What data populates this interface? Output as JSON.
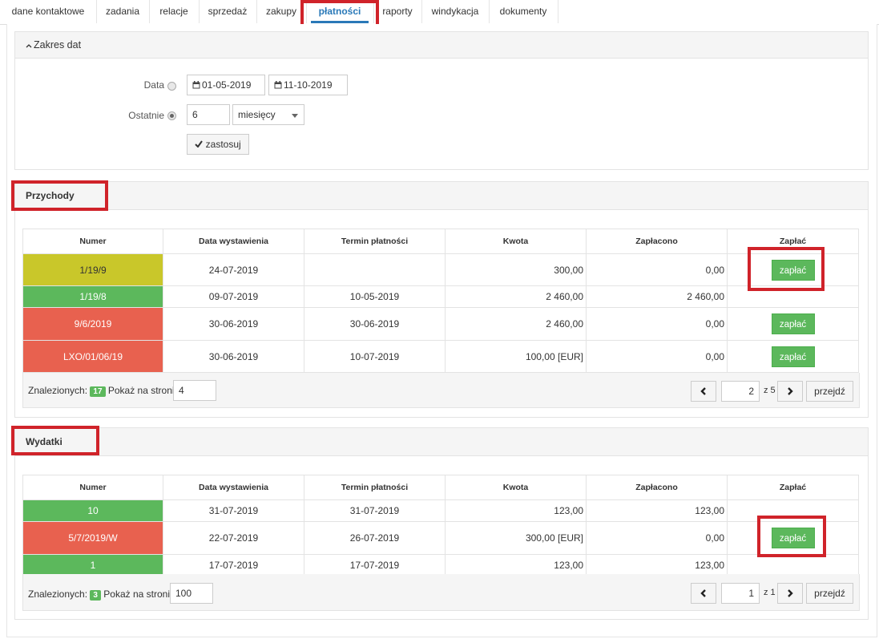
{
  "tabs": [
    "dane kontaktowe",
    "zadania",
    "relacje",
    "sprzedaż",
    "zakupy",
    "płatności",
    "raporty",
    "windykacja",
    "dokumenty"
  ],
  "date_range": {
    "title": "Zakres dat",
    "data_label": "Data",
    "date_from": "01-05-2019",
    "date_to": "11-10-2019",
    "last_label": "Ostatnie",
    "last_value": "6",
    "unit": "miesięcy",
    "apply_label": "zastosuj"
  },
  "columns": [
    "Numer",
    "Data wystawienia",
    "Termin płatności",
    "Kwota",
    "Zapłacono",
    "Zapłać"
  ],
  "pay_label": "zapłać",
  "income": {
    "title": "Przychody",
    "rows": [
      {
        "numer": "1/19/9",
        "data": "24-07-2019",
        "termin": "",
        "kwota": "300,00",
        "zaplacono": "0,00",
        "status_color": "#c9c72a",
        "pay": true
      },
      {
        "numer": "1/19/8",
        "data": "09-07-2019",
        "termin": "10-05-2019",
        "kwota": "2 460,00",
        "zaplacono": "2 460,00",
        "status_color": "#5cb85c",
        "pay": false
      },
      {
        "numer": "9/6/2019",
        "data": "30-06-2019",
        "termin": "30-06-2019",
        "kwota": "2 460,00",
        "zaplacono": "0,00",
        "status_color": "#e8614f",
        "pay": true
      },
      {
        "numer": "LXO/01/06/19",
        "data": "30-06-2019",
        "termin": "10-07-2019",
        "kwota": "100,00 [EUR]",
        "zaplacono": "0,00",
        "status_color": "#e8614f",
        "pay": true
      }
    ],
    "found_label": "Znalezionych:",
    "found_count": "17",
    "per_page_label": "Pokaż na stronie:",
    "per_page": "4",
    "page": "2",
    "of_pages": "z 5",
    "go_label": "przejdź"
  },
  "expenses": {
    "title": "Wydatki",
    "rows": [
      {
        "numer": "10",
        "data": "31-07-2019",
        "termin": "31-07-2019",
        "kwota": "123,00",
        "zaplacono": "123,00",
        "status_color": "#5cb85c",
        "pay": false
      },
      {
        "numer": "5/7/2019/W",
        "data": "22-07-2019",
        "termin": "26-07-2019",
        "kwota": "300,00 [EUR]",
        "zaplacono": "0,00",
        "status_color": "#e8614f",
        "pay": true
      },
      {
        "numer": "1",
        "data": "17-07-2019",
        "termin": "17-07-2019",
        "kwota": "123,00",
        "zaplacono": "123,00",
        "status_color": "#5cb85c",
        "pay": false
      }
    ],
    "found_label": "Znalezionych:",
    "found_count": "3",
    "per_page_label": "Pokaż na stronie:",
    "per_page": "100",
    "page": "1",
    "of_pages": "z 1",
    "go_label": "przejdź"
  },
  "colors": {
    "accent": "#2a79b8",
    "green": "#5cb85c",
    "red": "#e8614f",
    "yellow": "#c9c72a",
    "highlight": "#d0232a"
  }
}
